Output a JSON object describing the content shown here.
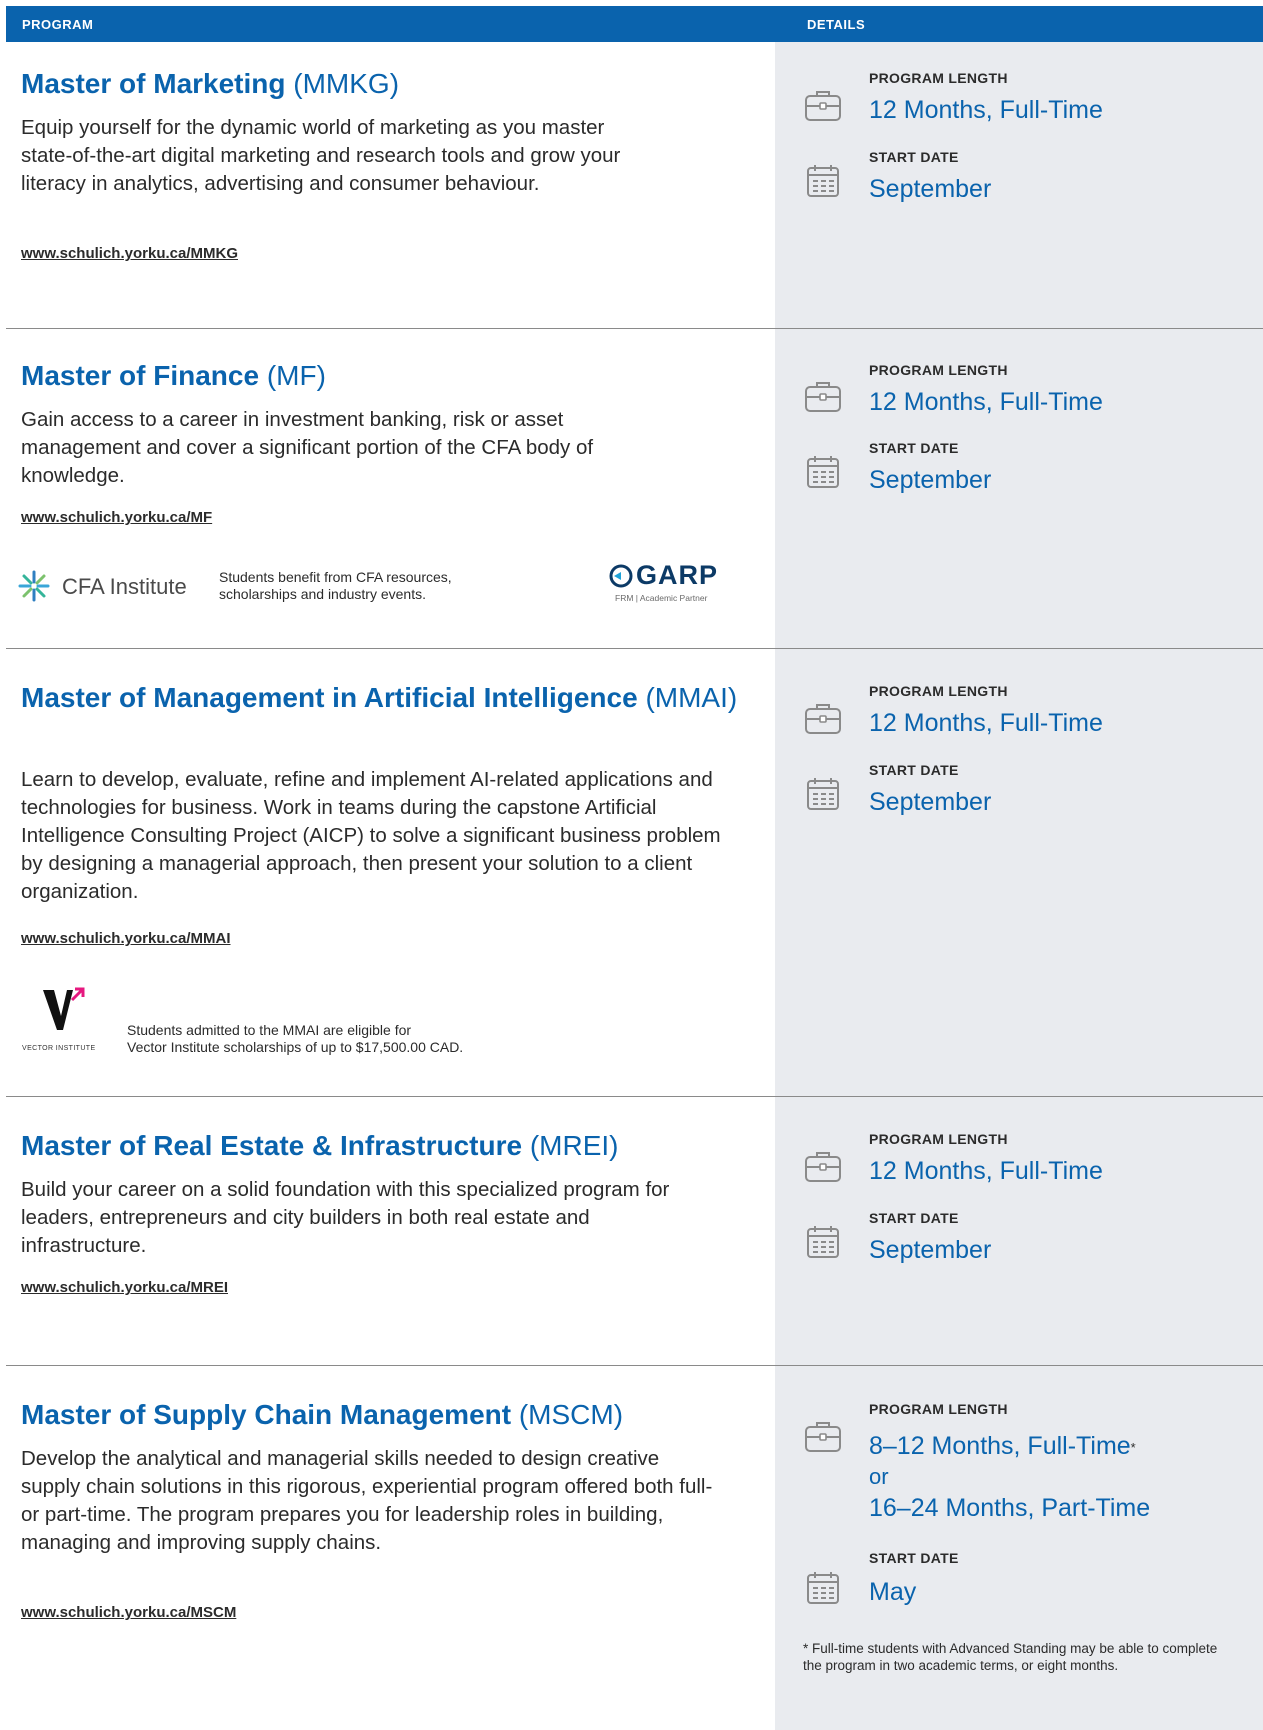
{
  "header": {
    "program": "PROGRAM",
    "details": "DETAILS"
  },
  "labels": {
    "length": "PROGRAM LENGTH",
    "start": "START DATE"
  },
  "programs": [
    {
      "name": "Master of Marketing",
      "abbr": "(MMKG)",
      "desc": "Equip yourself for the dynamic world of marketing as you master state-of-the-art digital marketing and research tools and grow your literacy in analytics, advertising and consumer behaviour.",
      "link": "www.schulich.yorku.ca/MMKG",
      "length": "12 Months, Full-Time",
      "start": "September"
    },
    {
      "name": "Master of Finance",
      "abbr": "(MF)",
      "desc": "Gain access to a career in investment banking, risk or asset management and cover a significant portion of the CFA body of knowledge.",
      "link": "www.schulich.yorku.ca/MF",
      "length": "12 Months, Full-Time",
      "start": "September"
    },
    {
      "name": "Master of Management in Artificial Intelligence",
      "abbr": "(MMAI)",
      "desc": "Learn to develop, evaluate, refine and implement AI-related applications and technologies for business. Work in teams during the capstone Artificial Intelligence Consulting Project (AICP) to solve a significant business problem by designing a managerial approach, then present your solution to a client organization.",
      "link": "www.schulich.yorku.ca/MMAI",
      "length": "12 Months, Full-Time",
      "start": "September"
    },
    {
      "name": "Master of Real Estate & Infrastructure",
      "abbr": "(MREI)",
      "desc": "Build your career on a solid foundation with this specialized program for leaders, entrepreneurs and city builders in both real estate and infrastructure.",
      "link": "www.schulich.yorku.ca/MREI",
      "length": "12 Months, Full-Time",
      "start": "September"
    },
    {
      "name": "Master of Supply Chain Management",
      "abbr": "(MSCM)",
      "desc": "Develop the analytical and managerial skills needed to design creative supply chain solutions in this rigorous, experiential program offered both full- or part-time. The program prepares you for leadership roles in building, managing and improving supply chains.",
      "link": "www.schulich.yorku.ca/MSCM",
      "length": "8–12 Months, Full-Time",
      "length_mark": "*",
      "length_or": "or",
      "length2": "16–24 Months, Part-Time",
      "start": "May",
      "footnote_mark": "*",
      "footnote": "Full-time students with Advanced Standing may be able to complete the program in two academic terms, or eight months."
    }
  ],
  "partners": {
    "cfa_name": "CFA Institute",
    "cfa_note_1": "Students benefit from CFA resources,",
    "cfa_note_2": "scholarships and industry events.",
    "garp_name": "GARP",
    "garp_sub": "FRM | Academic Partner",
    "vector_caption": "VECTOR INSTITUTE",
    "vector_note_1": "Students admitted to the MMAI are eligible for",
    "vector_note_2": "Vector Institute scholarships of up to $17,500.00 CAD."
  },
  "colors": {
    "brand_blue": "#0a63ad",
    "details_bg": "#e9ebef"
  }
}
